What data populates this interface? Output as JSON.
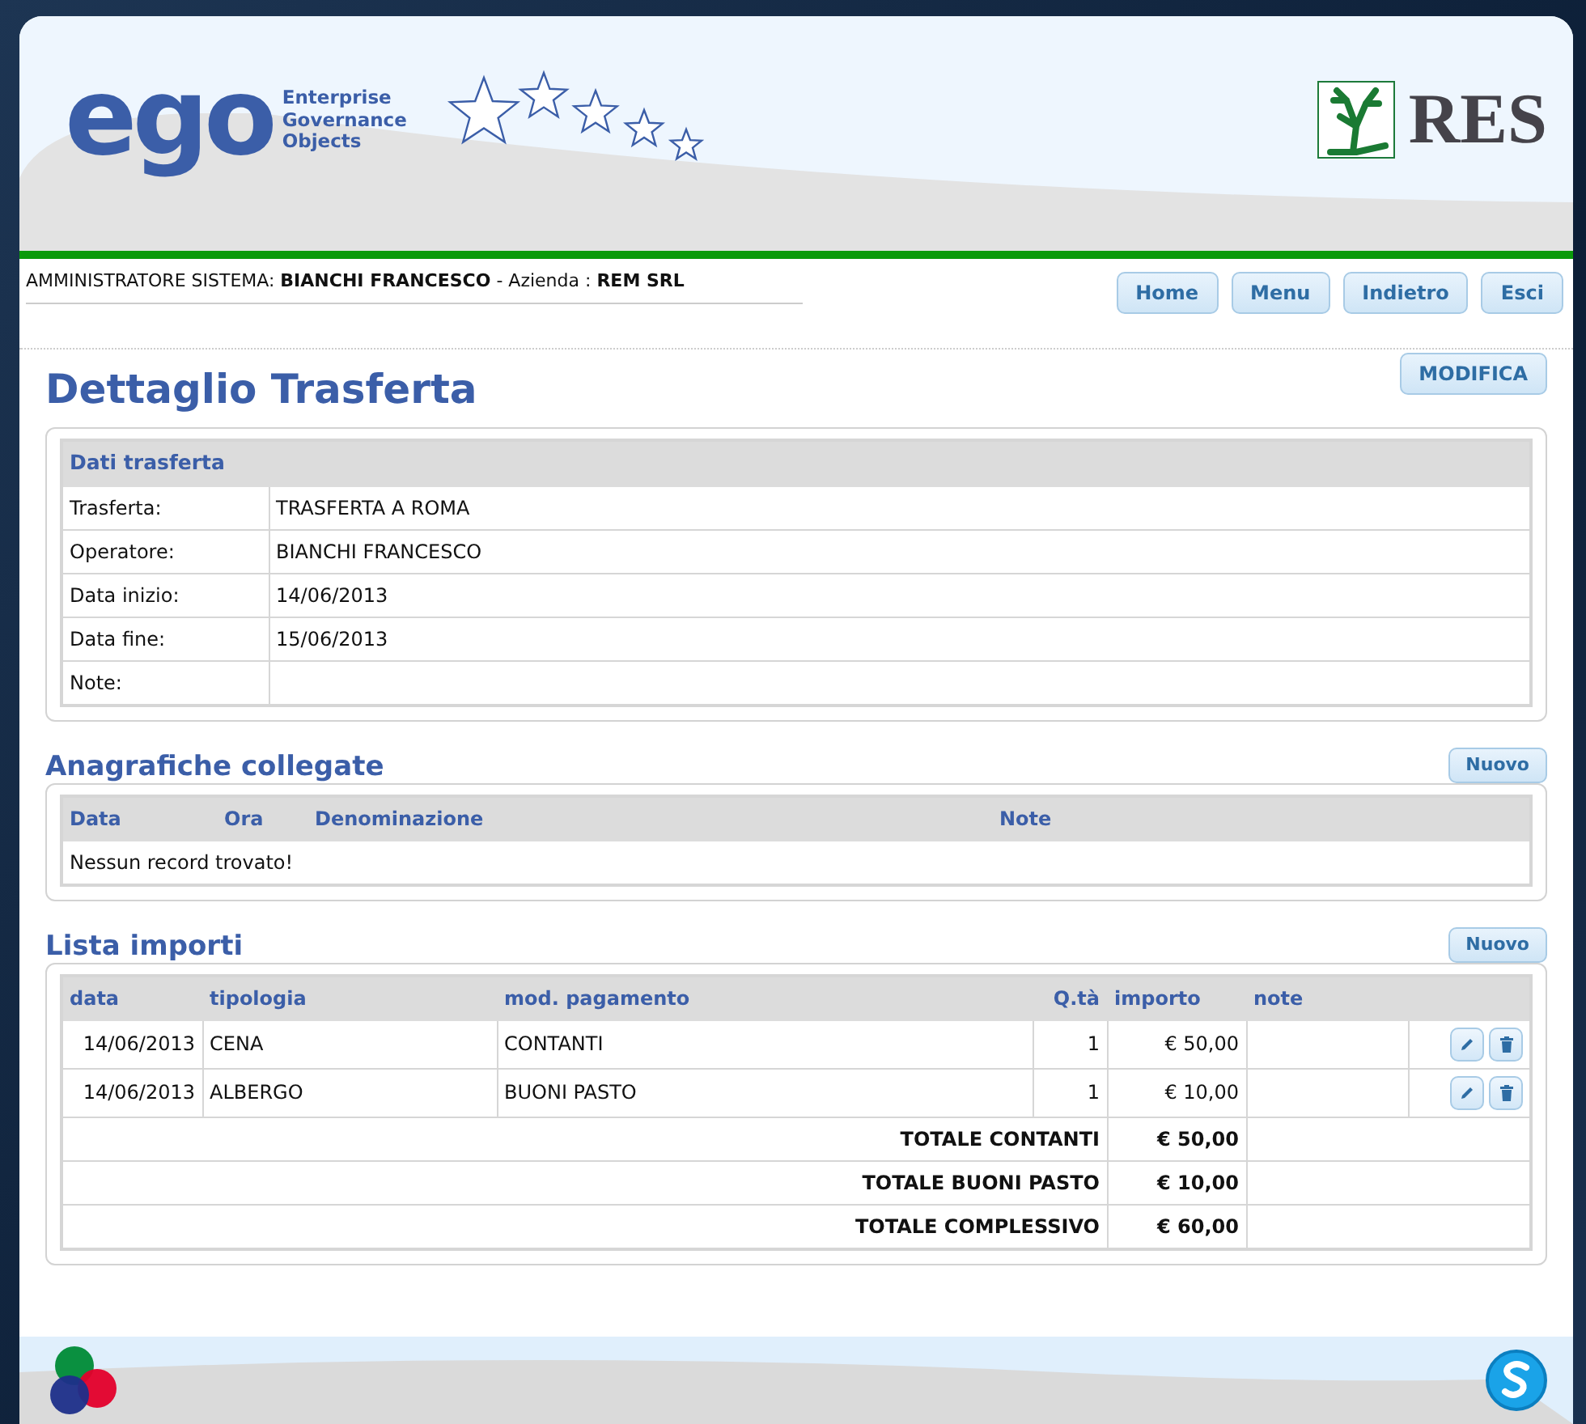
{
  "header": {
    "logo_word": "ego",
    "logo_tagline": [
      "Enterprise",
      "Governance",
      "Objects"
    ],
    "partner_logo": "RES"
  },
  "user_bar": {
    "text": "AMMINISTRATORE SISTEMA: **BIANCHI FRANCESCO** - Azienda : **REM SRL**"
  },
  "nav_buttons": [
    "Home",
    "Menu",
    "Indietro",
    "Esci"
  ],
  "page": {
    "title": "Dettaglio Trasferta",
    "edit_button": "MODIFICA"
  },
  "details": {
    "title": "Dati trasferta",
    "rows": [
      {
        "label": "Trasferta:",
        "value": "TRASFERTA A ROMA"
      },
      {
        "label": "Operatore:",
        "value": "BIANCHI FRANCESCO"
      },
      {
        "label": "Data inizio:",
        "value": "14/06/2013"
      },
      {
        "label": "Data fine:",
        "value": "15/06/2013"
      },
      {
        "label": "Note:",
        "value": ""
      }
    ]
  },
  "linked": {
    "title": "Anagrafiche collegate",
    "new_button": "Nuovo",
    "columns": [
      "Data",
      "Ora",
      "Denominazione",
      "Note"
    ],
    "empty_message": "Nessun record trovato!"
  },
  "amounts": {
    "title": "Lista importi",
    "new_button": "Nuovo",
    "columns": [
      "data",
      "tipologia",
      "mod. pagamento",
      "Q.tà",
      "importo",
      "note"
    ],
    "rows": [
      {
        "data": "14/06/2013",
        "tipologia": "CENA",
        "pagamento": "CONTANTI",
        "qta": "1",
        "importo": "€ 50,00",
        "note": ""
      },
      {
        "data": "14/06/2013",
        "tipologia": "ALBERGO",
        "pagamento": "BUONI PASTO",
        "qta": "1",
        "importo": "€ 10,00",
        "note": ""
      }
    ],
    "totals": [
      {
        "label": "TOTALE CONTANTI",
        "value": "€ 50,00"
      },
      {
        "label": "TOTALE BUONI PASTO",
        "value": "€ 10,00"
      },
      {
        "label": "TOTALE COMPLESSIVO",
        "value": "€ 60,00"
      }
    ]
  }
}
